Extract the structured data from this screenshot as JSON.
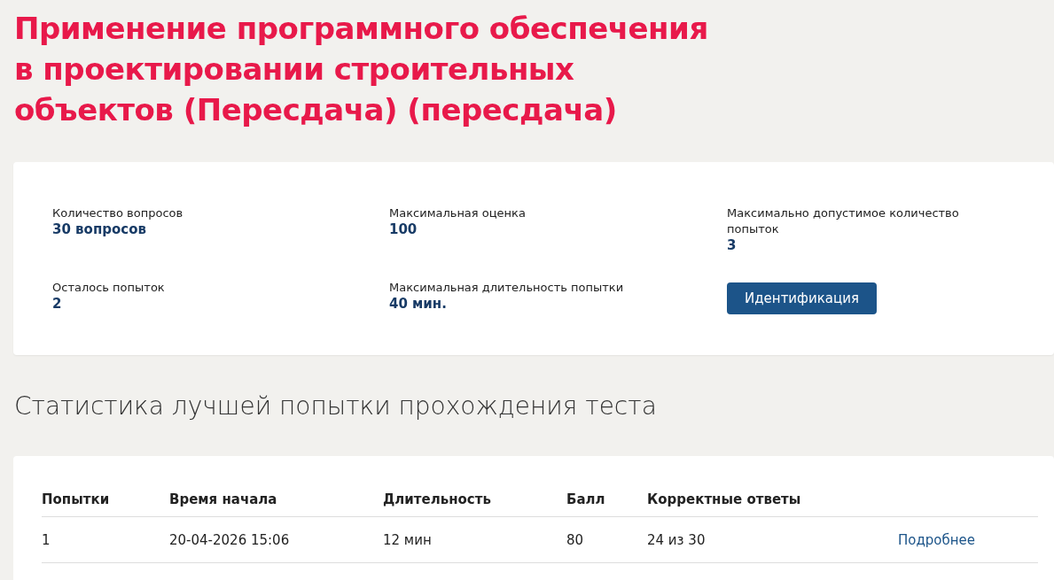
{
  "title": "Применение программного обеспечения в проектировании строительных объектов (Пересдача) (пересдача)",
  "summary": {
    "items": [
      {
        "label": "Количество вопросов",
        "value": "30 вопросов"
      },
      {
        "label": "Максимальная оценка",
        "value": "100"
      },
      {
        "label": "Максимально допустимое количество попыток",
        "value": "3"
      },
      {
        "label": "Осталось попыток",
        "value": "2"
      },
      {
        "label": "Максимальная длительность попытки",
        "value": "40 мин."
      }
    ],
    "button": "Идентификация"
  },
  "stats": {
    "heading": "Статистика лучшей попытки прохождения теста",
    "columns": [
      "Попытки",
      "Время начала",
      "Длительность",
      "Балл",
      "Корректные ответы"
    ],
    "rows": [
      {
        "cells": [
          "1",
          "20-04-2026 15:06",
          "12 мин",
          "80",
          "24 из 30"
        ],
        "link": "Подробнее"
      }
    ]
  }
}
